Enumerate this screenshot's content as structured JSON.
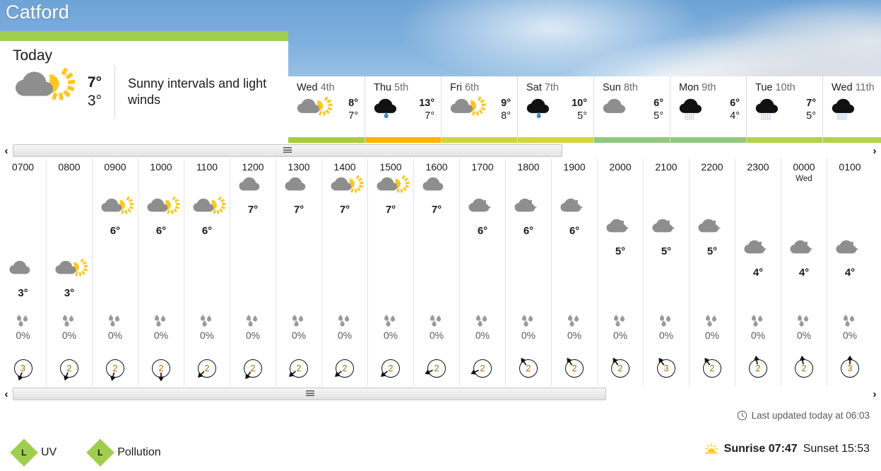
{
  "location": "Catford",
  "today": {
    "heading": "Today",
    "icon": "sunny-intervals-icon",
    "high": "7°",
    "low": "3°",
    "description": "Sunny intervals and light winds",
    "bar_color": "#9fce4e"
  },
  "days": [
    {
      "name": "Wed",
      "date": "4th",
      "icon": "sunny-intervals-icon",
      "high": "8°",
      "low": "7°",
      "bar_color": "#a6ce39"
    },
    {
      "name": "Thu",
      "date": "5th",
      "icon": "light-rain-icon",
      "high": "13°",
      "low": "7°",
      "bar_color": "#ffb400"
    },
    {
      "name": "Fri",
      "date": "6th",
      "icon": "sunny-intervals-icon",
      "high": "9°",
      "low": "8°",
      "bar_color": "#cdd63c"
    },
    {
      "name": "Sat",
      "date": "7th",
      "icon": "light-rain-icon",
      "high": "10°",
      "low": "5°",
      "bar_color": "#d6d53c"
    },
    {
      "name": "Sun",
      "date": "8th",
      "icon": "cloudy-icon",
      "high": "6°",
      "low": "5°",
      "bar_color": "#91c87e"
    },
    {
      "name": "Mon",
      "date": "9th",
      "icon": "drizzle-icon",
      "high": "6°",
      "low": "4°",
      "bar_color": "#91c87e"
    },
    {
      "name": "Tue",
      "date": "10th",
      "icon": "drizzle-icon",
      "high": "7°",
      "low": "5°",
      "bar_color": "#b4d24a"
    },
    {
      "name": "Wed",
      "date": "11th",
      "icon": "drizzle-icon",
      "high": "",
      "low": "",
      "bar_color": "#b4d24a"
    }
  ],
  "hourly": [
    {
      "time": "0700",
      "sub": "",
      "icon": "cloudy-icon",
      "temp": "3°",
      "precip": "0%",
      "wind": "3",
      "wind_deg": 200
    },
    {
      "time": "0800",
      "sub": "",
      "icon": "sunny-intervals-icon",
      "temp": "3°",
      "precip": "0%",
      "wind": "2",
      "wind_deg": 200
    },
    {
      "time": "0900",
      "sub": "",
      "icon": "sunny-intervals-icon",
      "temp": "6°",
      "precip": "0%",
      "wind": "2",
      "wind_deg": 195
    },
    {
      "time": "1000",
      "sub": "",
      "icon": "sunny-intervals-icon",
      "temp": "6°",
      "precip": "0%",
      "wind": "2",
      "wind_deg": 180
    },
    {
      "time": "1100",
      "sub": "",
      "icon": "sunny-intervals-icon",
      "temp": "6°",
      "precip": "0%",
      "wind": "2",
      "wind_deg": 225
    },
    {
      "time": "1200",
      "sub": "",
      "icon": "cloudy-icon",
      "temp": "7°",
      "precip": "0%",
      "wind": "2",
      "wind_deg": 215
    },
    {
      "time": "1300",
      "sub": "",
      "icon": "cloudy-icon",
      "temp": "7°",
      "precip": "0%",
      "wind": "2",
      "wind_deg": 230
    },
    {
      "time": "1400",
      "sub": "",
      "icon": "sunny-intervals-icon",
      "temp": "7°",
      "precip": "0%",
      "wind": "2",
      "wind_deg": 230
    },
    {
      "time": "1500",
      "sub": "",
      "icon": "sunny-intervals-icon",
      "temp": "7°",
      "precip": "0%",
      "wind": "2",
      "wind_deg": 230
    },
    {
      "time": "1600",
      "sub": "",
      "icon": "cloudy-icon",
      "temp": "7°",
      "precip": "0%",
      "wind": "2",
      "wind_deg": 245
    },
    {
      "time": "1700",
      "sub": "",
      "icon": "partly-cloudy-night-icon",
      "temp": "6°",
      "precip": "0%",
      "wind": "2",
      "wind_deg": 245
    },
    {
      "time": "1800",
      "sub": "",
      "icon": "partly-cloudy-night-icon",
      "temp": "6°",
      "precip": "0%",
      "wind": "2",
      "wind_deg": 325
    },
    {
      "time": "1900",
      "sub": "",
      "icon": "partly-cloudy-night-icon",
      "temp": "6°",
      "precip": "0%",
      "wind": "2",
      "wind_deg": 325
    },
    {
      "time": "2000",
      "sub": "",
      "icon": "partly-cloudy-night-icon",
      "temp": "5°",
      "precip": "0%",
      "wind": "2",
      "wind_deg": 325
    },
    {
      "time": "2100",
      "sub": "",
      "icon": "partly-cloudy-night-icon",
      "temp": "5°",
      "precip": "0%",
      "wind": "3",
      "wind_deg": 325
    },
    {
      "time": "2200",
      "sub": "",
      "icon": "partly-cloudy-night-icon",
      "temp": "5°",
      "precip": "0%",
      "wind": "2",
      "wind_deg": 325
    },
    {
      "time": "2300",
      "sub": "",
      "icon": "partly-cloudy-night-icon",
      "temp": "4°",
      "precip": "0%",
      "wind": "2",
      "wind_deg": 350
    },
    {
      "time": "0000",
      "sub": "Wed",
      "icon": "partly-cloudy-night-icon",
      "temp": "4°",
      "precip": "0%",
      "wind": "2",
      "wind_deg": 350
    },
    {
      "time": "0100",
      "sub": "",
      "icon": "partly-cloudy-night-icon",
      "temp": "4°",
      "precip": "0%",
      "wind": "3",
      "wind_deg": 360
    }
  ],
  "scrollbars": {
    "left_arrow": "‹",
    "right_arrow": "›"
  },
  "footer": {
    "updated_text": "Last updated today at 06:03",
    "updated_icon": "clock-icon",
    "badges": [
      {
        "level": "L",
        "label": "UV",
        "color": "#9fce4e"
      },
      {
        "level": "L",
        "label": "Pollution",
        "color": "#9fce4e"
      }
    ],
    "sun_icon": "sunrise-icon",
    "sunrise_label": "Sunrise 07:47",
    "sunset_label": "Sunset 15:53"
  },
  "colors": {
    "cloud_grey": "#8e8e8e",
    "cloud_black": "#111111",
    "sun_yellow": "#ffc61e",
    "rain_blue": "#3f8fd0",
    "drizzle_blue": "#5aa9e0",
    "drop_grey": "#9a9a9a"
  }
}
